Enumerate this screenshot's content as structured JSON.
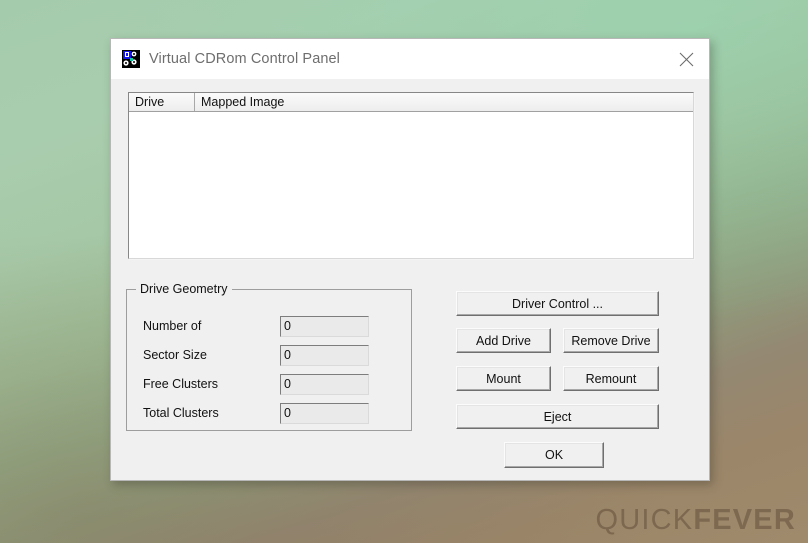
{
  "window": {
    "title": "Virtual CDRom Control Panel",
    "icon": "cdrom-app-icon",
    "close_label": "×"
  },
  "listview": {
    "columns": [
      {
        "key": "drive",
        "label": "Drive"
      },
      {
        "key": "mapped_image",
        "label": "Mapped Image"
      }
    ],
    "rows": []
  },
  "drive_geometry": {
    "title": "Drive Geometry",
    "fields": [
      {
        "label": "Number of",
        "value": "0"
      },
      {
        "label": "Sector Size",
        "value": "0"
      },
      {
        "label": "Free Clusters",
        "value": "0"
      },
      {
        "label": "Total Clusters",
        "value": "0"
      }
    ]
  },
  "buttons": {
    "driver_control": "Driver Control ...",
    "add_drive": "Add Drive",
    "remove_drive": "Remove Drive",
    "mount": "Mount",
    "remount": "Remount",
    "eject": "Eject",
    "ok": "OK"
  },
  "watermark": {
    "part1": "QUICK",
    "part2": "FEVER"
  },
  "colors": {
    "desktop_top": "#a4cbac",
    "desktop_bottom": "#a08a6c",
    "dialog_face": "#f0f0f0",
    "titlebar": "#ffffff",
    "title_text": "#6e6e6e",
    "field_face": "#eaeaea",
    "listview_face": "#ffffff"
  }
}
